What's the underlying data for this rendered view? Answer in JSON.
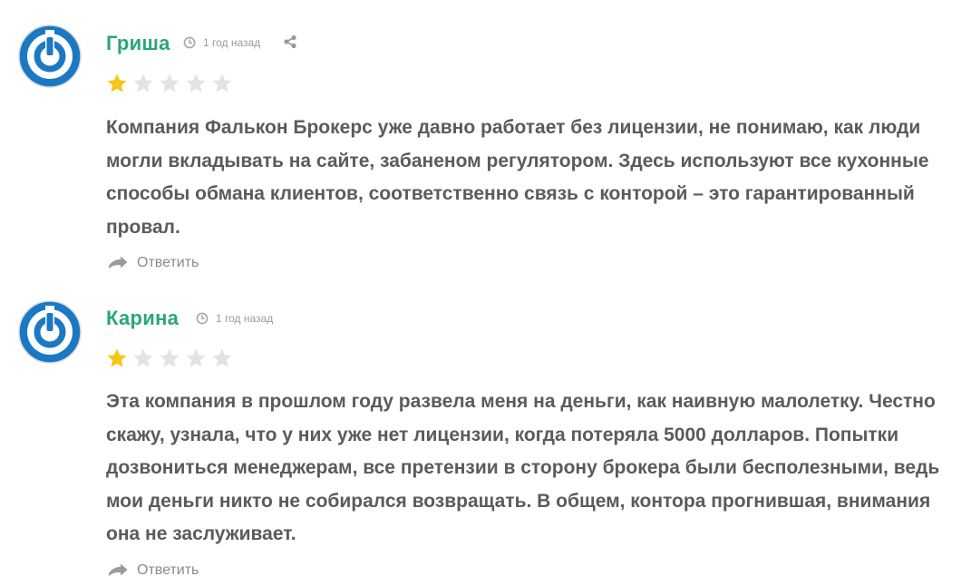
{
  "comments": [
    {
      "author": "Гриша",
      "time": "1 год назад",
      "rating": 1,
      "max_rating": 5,
      "show_share": true,
      "text": "Компания Фалькон Брокерс уже давно работает без лицензии, не понимаю, как люди могли вкладывать на сайте, забаненом регулятором. Здесь используют все кухонные способы обмана клиентов, соответственно связь с конторой – это гарантированный провал.",
      "reply_label": "Ответить"
    },
    {
      "author": "Карина",
      "time": "1 год назад",
      "rating": 1,
      "max_rating": 5,
      "show_share": false,
      "text": "Эта компания в прошлом году развела меня на деньги, как наивную малолетку. Честно скажу, узнала, что у них уже нет лицензии, когда потеряла 5000 долларов. Попытки дозвониться менеджерам, все претензии в сторону брокера были бесполезными, ведь мои деньги никто не собирался возвращать. В общем, контора прогнившая, внимания она не заслуживает.",
      "reply_label": "Ответить"
    }
  ],
  "colors": {
    "author": "#2aa67a",
    "star_filled": "#f5c518",
    "star_empty": "#e3e3e3",
    "text": "#5b5b5b",
    "muted": "#9a9a9a",
    "avatar_blue": "#1b79c4"
  },
  "icons": {
    "avatar": "power-button-avatar",
    "time": "clock-icon",
    "share": "share-icon",
    "reply": "reply-arrow-icon",
    "star": "star-icon"
  }
}
